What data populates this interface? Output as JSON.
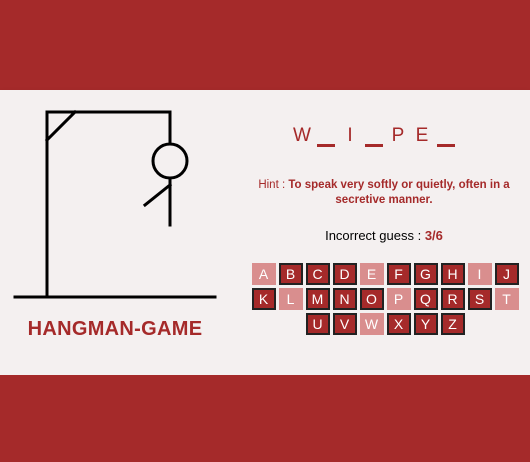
{
  "game": {
    "title": "HANGMAN-GAME",
    "word_slots": [
      {
        "letter": "W",
        "revealed": true
      },
      {
        "letter": "",
        "revealed": false
      },
      {
        "letter": "I",
        "revealed": true
      },
      {
        "letter": "",
        "revealed": false
      },
      {
        "letter": "P",
        "revealed": true
      },
      {
        "letter": "E",
        "revealed": true
      },
      {
        "letter": "",
        "revealed": false
      }
    ],
    "hint_label": "Hint :",
    "hint_text": "To speak very softly or quietly, often in a secretive manner.",
    "incorrect_label": "Incorrect guess :",
    "incorrect_count": "3/6",
    "keyboard": [
      {
        "letter": "A",
        "used": true
      },
      {
        "letter": "B",
        "used": false
      },
      {
        "letter": "C",
        "used": false
      },
      {
        "letter": "D",
        "used": false
      },
      {
        "letter": "E",
        "used": true
      },
      {
        "letter": "F",
        "used": false
      },
      {
        "letter": "G",
        "used": false
      },
      {
        "letter": "H",
        "used": false
      },
      {
        "letter": "I",
        "used": true
      },
      {
        "letter": "J",
        "used": false
      },
      {
        "letter": "K",
        "used": false
      },
      {
        "letter": "L",
        "used": true
      },
      {
        "letter": "M",
        "used": false
      },
      {
        "letter": "N",
        "used": false
      },
      {
        "letter": "O",
        "used": false
      },
      {
        "letter": "P",
        "used": true
      },
      {
        "letter": "Q",
        "used": false
      },
      {
        "letter": "R",
        "used": false
      },
      {
        "letter": "S",
        "used": false
      },
      {
        "letter": "T",
        "used": true
      },
      {
        "letter": "U",
        "used": false
      },
      {
        "letter": "V",
        "used": false
      },
      {
        "letter": "W",
        "used": true
      },
      {
        "letter": "X",
        "used": false
      },
      {
        "letter": "Y",
        "used": false
      },
      {
        "letter": "Z",
        "used": false
      }
    ],
    "colors": {
      "accent": "#a52a2a",
      "used_key": "#d98e8e",
      "panel": "#f4f0f0"
    }
  }
}
